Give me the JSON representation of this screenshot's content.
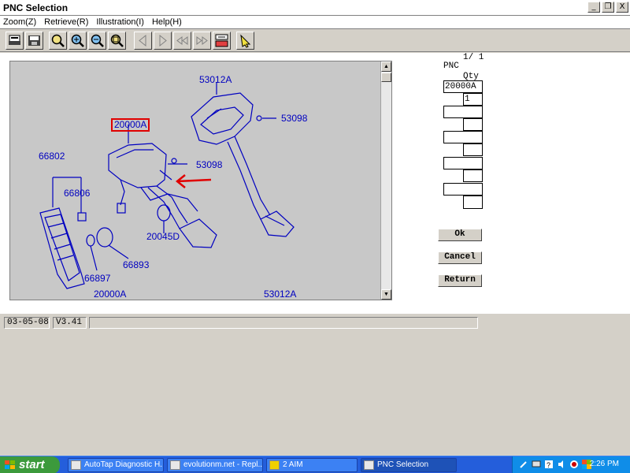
{
  "window": {
    "title": "PNC Selection",
    "controls": [
      "_",
      "❐",
      "X"
    ]
  },
  "menu": {
    "items": [
      "Zoom(Z)",
      "Retrieve(R)",
      "Illustration(I)",
      "Help(H)"
    ]
  },
  "toolbar": {
    "buttons": [
      "print-icon",
      "save-icon",
      "zoom-icon",
      "zoom-in-icon",
      "zoom-out-icon",
      "zoom-fit-icon",
      "prev-icon",
      "next-icon",
      "first-icon",
      "last-icon",
      "lock-icon",
      "pointer-icon"
    ]
  },
  "illustration": {
    "callouts": {
      "c53012a_top": "53012A",
      "c20000a_box": "20000A",
      "c53098_right": "53098",
      "c66802": "66802",
      "c53098_mid": "53098",
      "c66806": "66806",
      "c20045d": "20045D",
      "c66893": "66893",
      "c66897": "66897",
      "c20000a_bottom": "20000A",
      "c53012a_bottom": "53012A"
    },
    "highlight_color": "#e00000",
    "line_color": "#0000c0"
  },
  "pnc_panel": {
    "page": "1/ 1",
    "pnc_label": "PNC",
    "qty_label": "Qty",
    "rows": [
      {
        "pnc": "20000A",
        "qty": "1"
      },
      {
        "pnc": "",
        "qty": ""
      },
      {
        "pnc": "",
        "qty": ""
      },
      {
        "pnc": "",
        "qty": ""
      },
      {
        "pnc": "",
        "qty": ""
      }
    ],
    "ok_label": "Ok",
    "cancel_label": "Cancel",
    "return_label": "Return"
  },
  "status": {
    "date": "03-05-08",
    "version": "V3.41",
    "message": ""
  },
  "taskbar": {
    "start_label": "start",
    "tasks": [
      "AutoTap Diagnostic H...",
      "evolutionm.net - Repl...",
      "2 AIM",
      "PNC Selection"
    ],
    "clock": "2:26 PM"
  }
}
